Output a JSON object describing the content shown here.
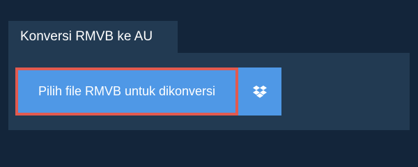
{
  "tab": {
    "title": "Konversi RMVB ke AU"
  },
  "upload": {
    "button_label": "Pilih file RMVB untuk dikonversi"
  },
  "icons": {
    "dropbox": "dropbox-icon"
  },
  "colors": {
    "background": "#13253a",
    "panel": "#223a52",
    "button": "#4f98e6",
    "focus_border": "#e25a4f",
    "text": "#ffffff"
  }
}
